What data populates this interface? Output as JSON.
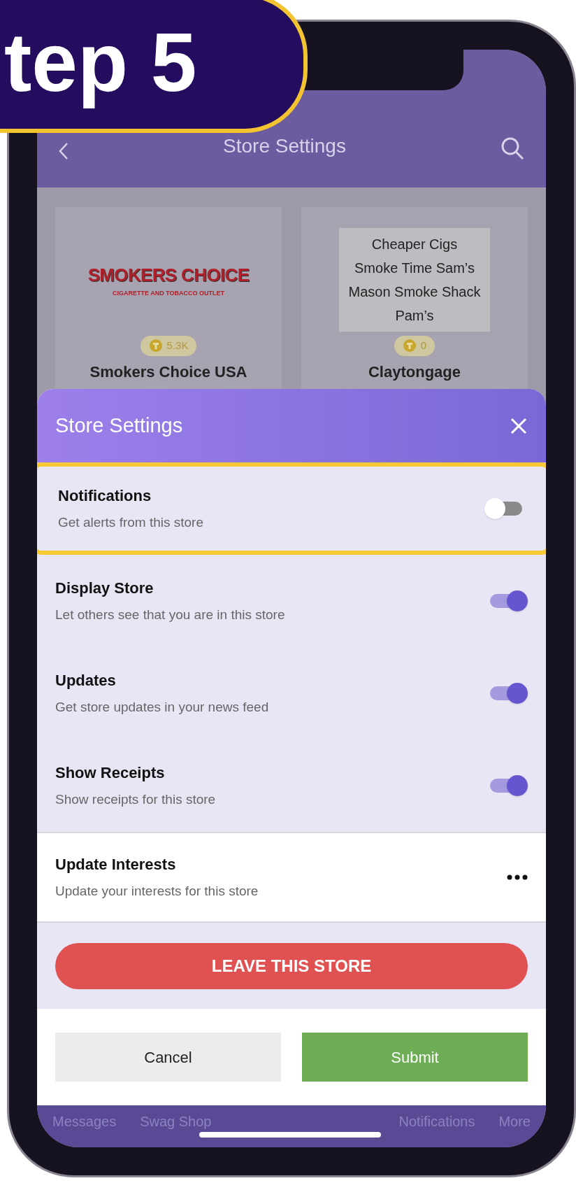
{
  "badge": {
    "text": "tep 5"
  },
  "header": {
    "title": "Store Settings"
  },
  "stores": [
    {
      "kind": "logo",
      "logo_text": "SMOKERS CHOICE",
      "logo_subtext": "CIGARETTE AND TOBACCO OUTLET",
      "points": "5.3K",
      "name": "Smokers Choice USA"
    },
    {
      "kind": "list",
      "names": [
        "Cheaper Cigs",
        "Smoke Time Sam’s",
        "Mason Smoke Shack",
        "Pam’s"
      ],
      "points": "0",
      "name": "Claytongage"
    }
  ],
  "sheet": {
    "title": "Store Settings",
    "settings": [
      {
        "title": "Notifications",
        "subtitle": "Get alerts from this store",
        "on": false,
        "highlighted": true
      },
      {
        "title": "Display Store",
        "subtitle": "Let others see that you are in this store",
        "on": true,
        "highlighted": false
      },
      {
        "title": "Updates",
        "subtitle": "Get store updates in your news feed",
        "on": true,
        "highlighted": false
      },
      {
        "title": "Show Receipts",
        "subtitle": "Show receipts for this store",
        "on": true,
        "highlighted": false
      }
    ],
    "interests": {
      "title": "Update Interests",
      "subtitle": "Update your interests for this store"
    },
    "leave_button": "LEAVE THIS STORE",
    "cancel_button": "Cancel",
    "submit_button": "Submit"
  },
  "bottom_nav": [
    "Messages",
    "Swag Shop",
    "Notifications",
    "More"
  ]
}
